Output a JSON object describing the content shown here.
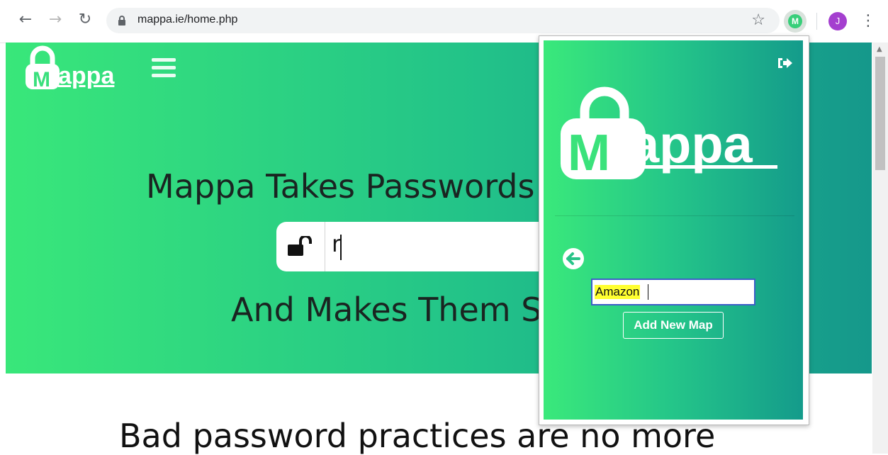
{
  "browser": {
    "url": "mappa.ie/home.php",
    "avatar_letter": "J",
    "extension_letter": "M"
  },
  "site": {
    "logo_text": "appa",
    "logo_letter": "M",
    "headline": "Mappa Takes Passwords",
    "password_value": "r",
    "subheadline": "And Makes Them S",
    "section_title": "Bad password practices are no more"
  },
  "popup": {
    "logo_letter": "M",
    "logo_text": "appa",
    "map_input_value": "Amazon",
    "add_button_label": "Add New Map"
  },
  "colors": {
    "brand_green": "#39e77a",
    "brand_teal": "#15988b",
    "avatar": "#a43fcf"
  }
}
